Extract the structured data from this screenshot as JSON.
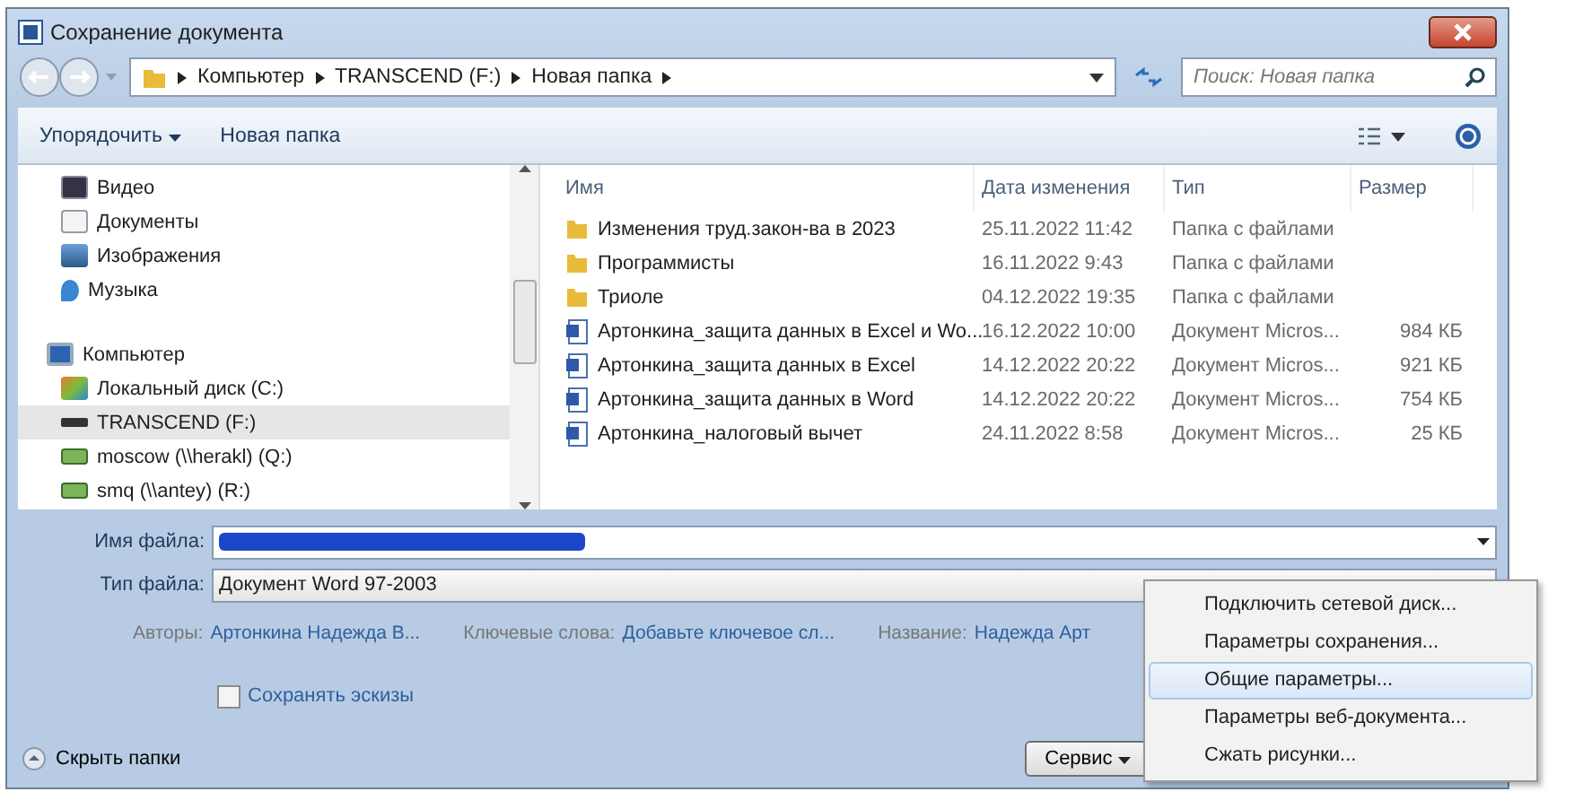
{
  "window": {
    "title": "Сохранение документа"
  },
  "address": {
    "crumbs": [
      "Компьютер",
      "TRANSCEND (F:)",
      "Новая папка"
    ]
  },
  "search": {
    "placeholder": "Поиск: Новая папка"
  },
  "toolbar": {
    "organize": "Упорядочить",
    "new_folder": "Новая папка"
  },
  "sidebar": {
    "items": [
      {
        "kind": "video",
        "label": "Видео",
        "selected": false
      },
      {
        "kind": "documents",
        "label": "Документы",
        "selected": false
      },
      {
        "kind": "images",
        "label": "Изображения",
        "selected": false
      },
      {
        "kind": "music",
        "label": "Музыка",
        "selected": false
      },
      {
        "kind": "computer",
        "label": "Компьютер",
        "selected": false,
        "children": [
          {
            "kind": "disk",
            "label": "Локальный диск (C:)",
            "selected": false
          },
          {
            "kind": "usb",
            "label": "TRANSCEND (F:)",
            "selected": true
          },
          {
            "kind": "network",
            "label": "moscow (\\\\herakl) (Q:)",
            "selected": false
          },
          {
            "kind": "network",
            "label": "smq (\\\\antey) (R:)",
            "selected": false
          }
        ]
      }
    ]
  },
  "table": {
    "columns": [
      "Имя",
      "Дата изменения",
      "Тип",
      "Размер"
    ],
    "rows": [
      {
        "kind": "folder",
        "name": "Изменения труд.закон-ва в 2023",
        "date": "25.11.2022 11:42",
        "type": "Папка с файлами"
      },
      {
        "kind": "folder",
        "name": "Программисты",
        "date": "16.11.2022 9:43",
        "type": "Папка с файлами"
      },
      {
        "kind": "folder",
        "name": "Триоле",
        "date": "04.12.2022 19:35",
        "type": "Папка с файлами"
      },
      {
        "kind": "doc",
        "name": "Артонкина_защита данных в Excel и Wo...",
        "date": "16.12.2022 10:00",
        "type": "Документ Micros...",
        "size": "984 КБ"
      },
      {
        "kind": "doc",
        "name": "Артонкина_защита данных в Excel",
        "date": "14.12.2022 20:22",
        "type": "Документ Micros...",
        "size": "921 КБ"
      },
      {
        "kind": "doc",
        "name": "Артонкина_защита данных в Word",
        "date": "14.12.2022 20:22",
        "type": "Документ Micros...",
        "size": "754 КБ"
      },
      {
        "kind": "doc",
        "name": "Артонкина_налоговый вычет",
        "date": "24.11.2022 8:58",
        "type": "Документ Micros...",
        "size": "25 КБ"
      }
    ]
  },
  "form": {
    "file_name_label": "Имя файла:",
    "file_type_label": "Тип файла:",
    "file_type": "Документ Word 97-2003",
    "meta": [
      {
        "label": "Авторы:",
        "value": "Артонкина Надежда В..."
      },
      {
        "label": "Ключевые слова:",
        "value": "Добавьте ключевое сл..."
      },
      {
        "label": "Название:",
        "value": "Надежда Арт"
      }
    ],
    "thumbnails": {
      "label": "Сохранять эскизы",
      "checked": false
    }
  },
  "hide_folders": "Скрыть папки",
  "tools_button": "Сервис",
  "tools_menu": [
    {
      "label": "Подключить сетевой диск...",
      "selected": false
    },
    {
      "label": "Параметры сохранения...",
      "selected": false
    },
    {
      "label": "Общие параметры...",
      "selected": true
    },
    {
      "label": "Параметры веб-документа...",
      "selected": false
    },
    {
      "label": "Сжать рисунки...",
      "selected": false
    }
  ]
}
